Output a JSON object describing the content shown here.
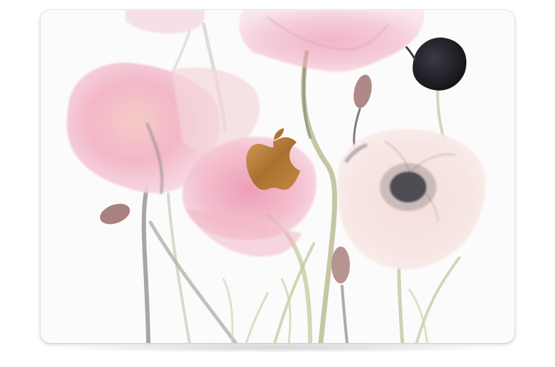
{
  "image": {
    "subject": "laptop-skin-watercolor-poppies",
    "background_color": "#ffffff",
    "lid_color": "#fcfbfb",
    "colors": {
      "pink_light": "#f6d3dc",
      "pink_mid": "#ee9fb6",
      "blush": "#f3ddd6",
      "stem_green": "#b9b98f",
      "dark_ink": "#1e1f24",
      "poppy_center": "#2f3138",
      "bud_mauve": "#9a6b6a",
      "logo_gold": "#b27a3c"
    },
    "icons": [
      "apple-logo-icon"
    ]
  }
}
